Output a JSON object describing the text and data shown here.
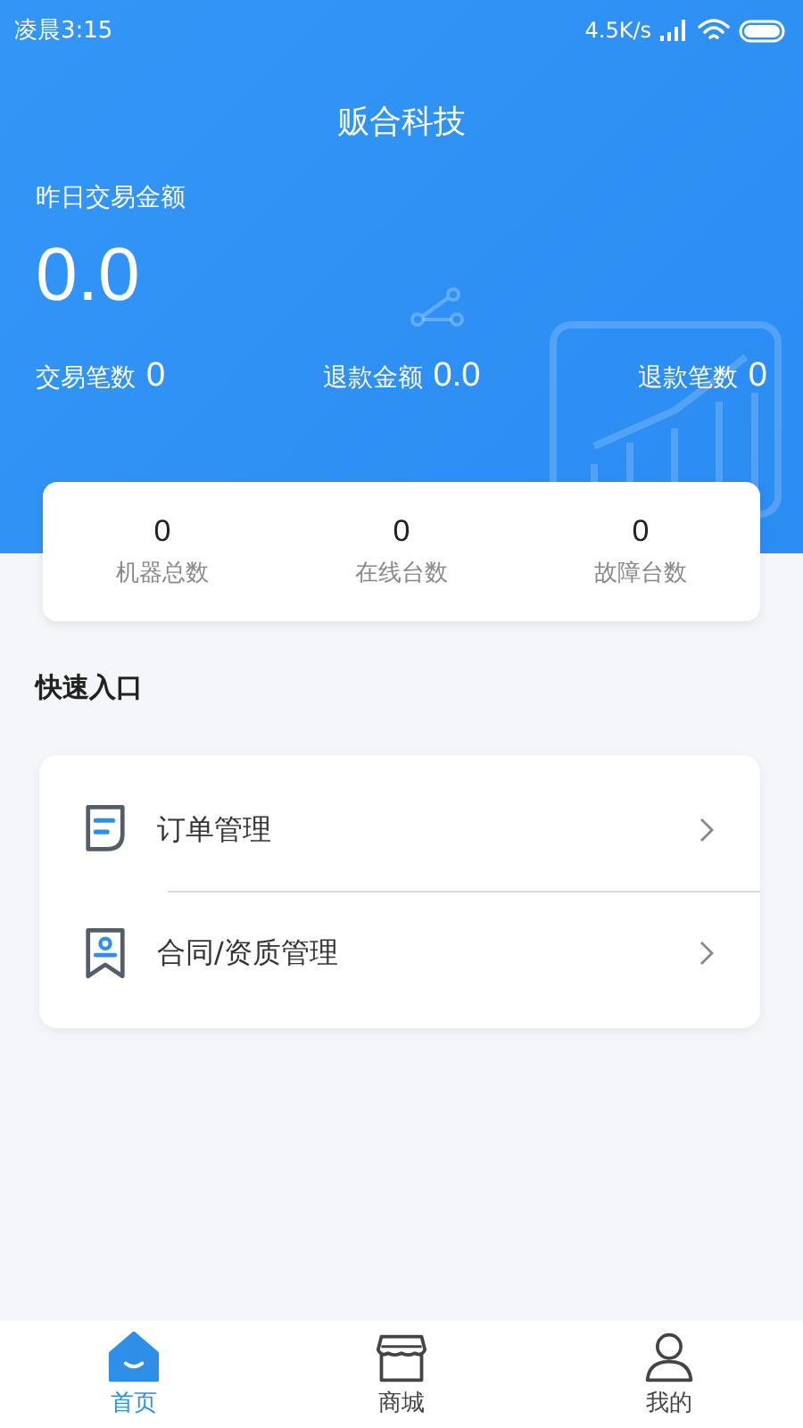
{
  "status_bar": {
    "time": "凌晨3:15",
    "speed": "4.5K/s"
  },
  "header": {
    "title": "贩合科技"
  },
  "summary": {
    "label": "昨日交易金额",
    "amount": "0.0",
    "stats": [
      {
        "label": "交易笔数",
        "value": "0"
      },
      {
        "label": "退款金额",
        "value": "0.0"
      },
      {
        "label": "退款笔数",
        "value": "0"
      }
    ]
  },
  "machines": [
    {
      "value": "0",
      "label": "机器总数"
    },
    {
      "value": "0",
      "label": "在线台数"
    },
    {
      "value": "0",
      "label": "故障台数"
    }
  ],
  "quick_entry": {
    "title": "快速入口",
    "items": [
      {
        "kind": "order",
        "label": "订单管理"
      },
      {
        "kind": "contract",
        "label": "合同/资质管理"
      }
    ]
  },
  "tabs": [
    {
      "kind": "home",
      "label": "首页",
      "selected": true
    },
    {
      "kind": "shop",
      "label": "商城",
      "selected": false
    },
    {
      "kind": "profile",
      "label": "我的",
      "selected": false
    }
  ]
}
